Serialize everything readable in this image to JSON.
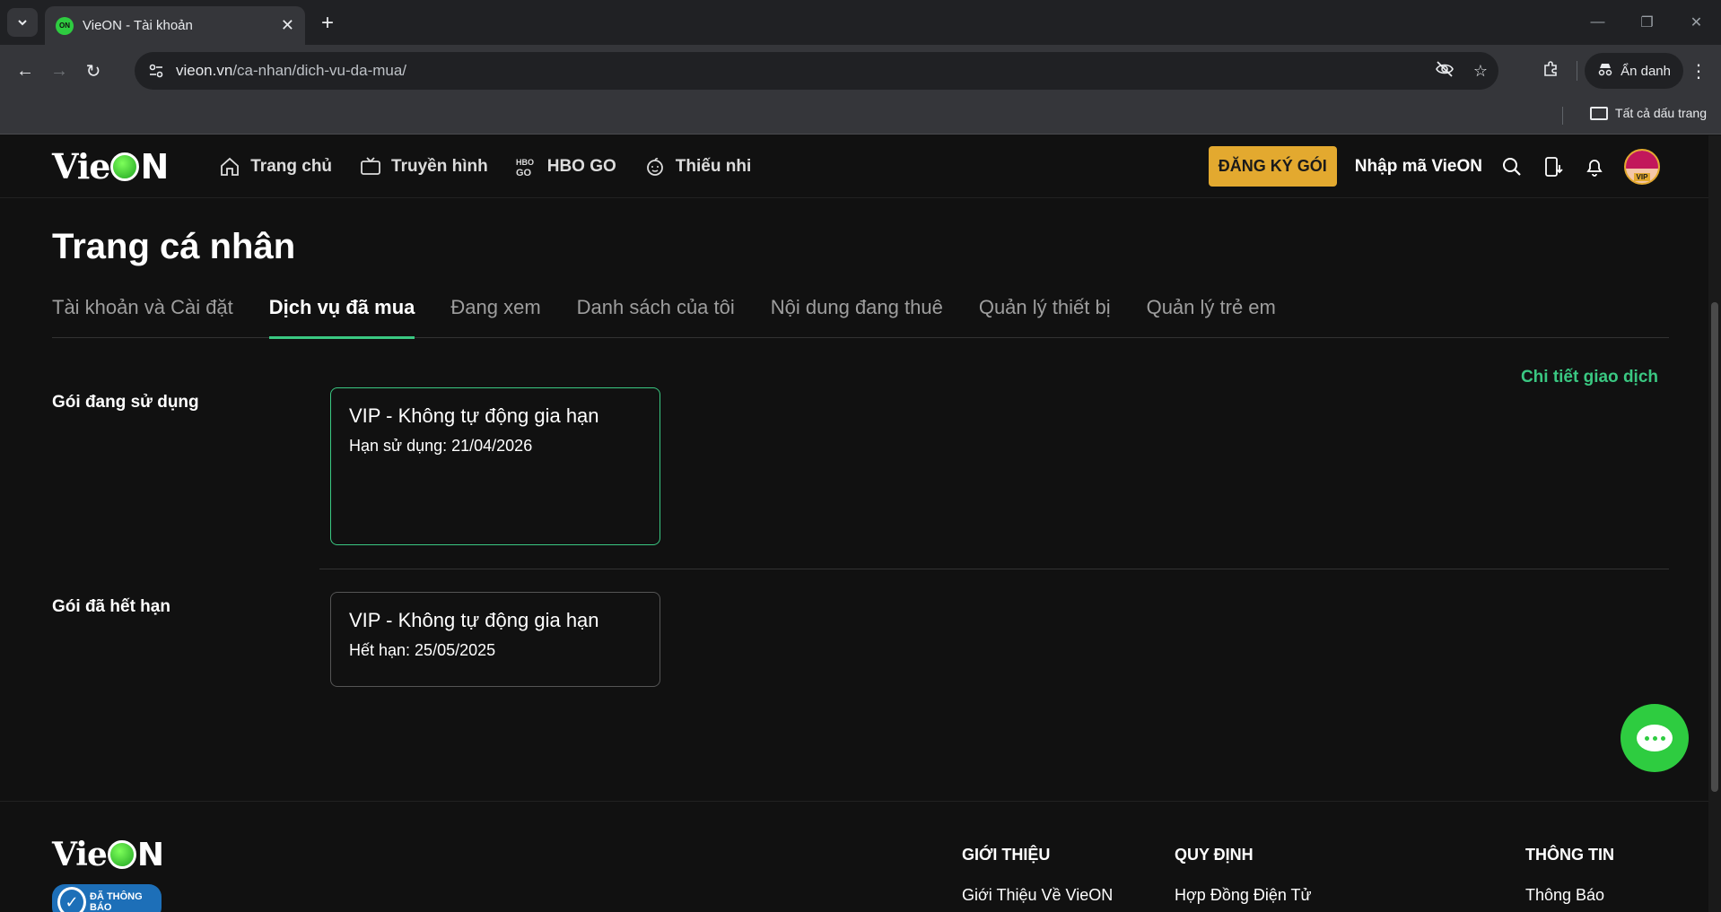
{
  "browser": {
    "tab_title": "VieON - Tài khoản",
    "favicon_text": "ON",
    "new_tab": "+",
    "url_host": "vieon.vn",
    "url_path": "/ca-nhan/dich-vu-da-mua/",
    "incognito_label": "Ẩn danh",
    "bookmarks_all": "Tất cả dấu trang"
  },
  "header": {
    "logo_vie": "Vie",
    "logo_n": "N",
    "nav": [
      {
        "label": "Trang chủ",
        "icon": "home-icon"
      },
      {
        "label": "Truyền hình",
        "icon": "tv-icon"
      },
      {
        "label": "HBO GO",
        "icon": "hbo-go-icon"
      },
      {
        "label": "Thiếu nhi",
        "icon": "kids-icon"
      }
    ],
    "subscribe_label": "ĐĂNG KÝ GÓI",
    "code_label": "Nhập mã VieON",
    "avatar_badge": "VIP"
  },
  "main": {
    "page_title": "Trang cá nhân",
    "tabs": [
      {
        "label": "Tài khoản và Cài đặt",
        "active": false
      },
      {
        "label": "Dịch vụ đã mua",
        "active": true
      },
      {
        "label": "Đang xem",
        "active": false
      },
      {
        "label": "Danh sách của tôi",
        "active": false
      },
      {
        "label": "Nội dung đang thuê",
        "active": false
      },
      {
        "label": "Quản lý thiết bị",
        "active": false
      },
      {
        "label": "Quản lý trẻ em",
        "active": false
      }
    ],
    "transaction_link": "Chi tiết giao dịch",
    "active_section": {
      "label": "Gói đang sử dụng",
      "package_name": "VIP - Không tự động gia hạn",
      "package_date": "Hạn sử dụng: 21/04/2026"
    },
    "expired_section": {
      "label": "Gói đã hết hạn",
      "package_name": "VIP - Không tự động gia hạn",
      "package_date": "Hết hạn: 25/05/2025"
    }
  },
  "footer": {
    "badge_text": "ĐÃ THÔNG BÁO",
    "col1_heading": "GIỚI THIỆU",
    "col1_item": "Giới Thiệu Về VieON",
    "col2_heading": "QUY ĐỊNH",
    "col2_item": "Hợp Đồng Điện Tử",
    "col3_heading": "THÔNG TIN",
    "col3_item": "Thông Báo"
  },
  "colors": {
    "accent_green": "#3ac882",
    "subscribe_gold": "#e3a92f",
    "background": "#111111"
  }
}
